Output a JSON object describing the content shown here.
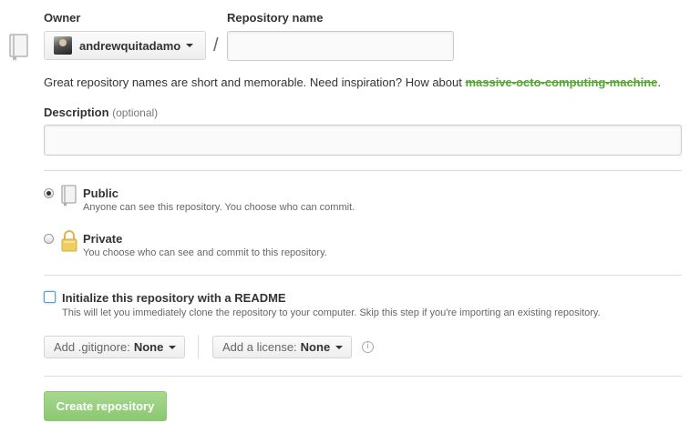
{
  "owner": {
    "label": "Owner",
    "name": "andrewquitadamo"
  },
  "repo_name": {
    "label": "Repository name",
    "value": "",
    "placeholder": ""
  },
  "separator": "/",
  "hint": {
    "text": "Great repository names are short and memorable. Need inspiration? How about ",
    "suggestion": "massive-octo-computing-machine",
    "end": "."
  },
  "description": {
    "label": "Description",
    "optional": "(optional)",
    "value": ""
  },
  "visibility": {
    "public": {
      "title": "Public",
      "note": "Anyone can see this repository. You choose who can commit.",
      "selected": true
    },
    "private": {
      "title": "Private",
      "note": "You choose who can see and commit to this repository.",
      "selected": false
    }
  },
  "readme": {
    "title": "Initialize this repository with a README",
    "note": "This will let you immediately clone the repository to your computer. Skip this step if you're importing an existing repository.",
    "checked": false
  },
  "gitignore": {
    "prefix": "Add .gitignore:",
    "value": "None"
  },
  "license": {
    "prefix": "Add a license:",
    "value": "None"
  },
  "info_icon": "info-icon",
  "create_button": "Create repository",
  "colors": {
    "suggestion": "#55a532",
    "create_bg": "#94cd79",
    "checkbox_border": "#5b9bd5"
  }
}
